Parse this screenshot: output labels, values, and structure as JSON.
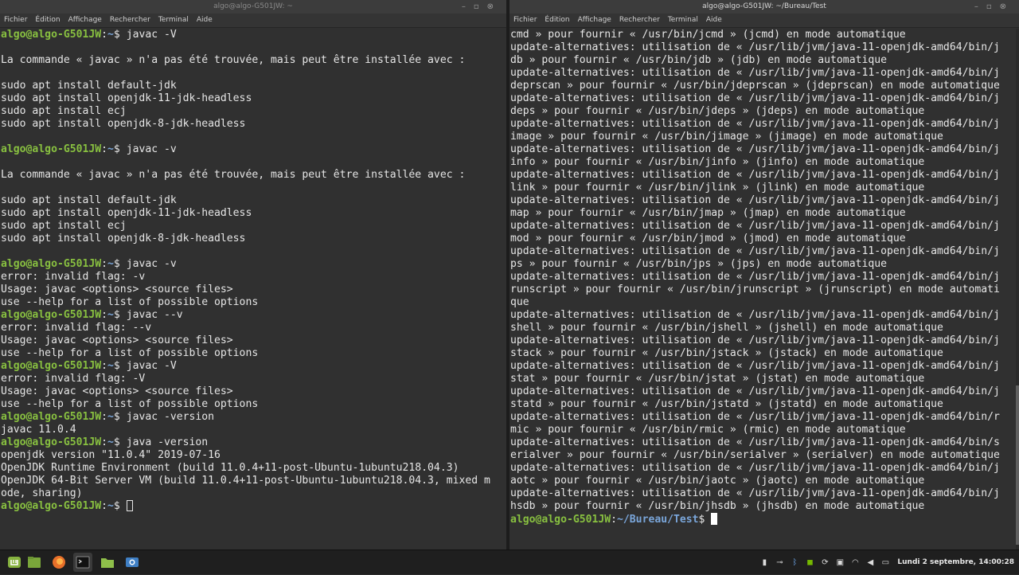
{
  "left": {
    "title": "algo@algo-G501JW: ~",
    "menu": [
      "Fichier",
      "Édition",
      "Affichage",
      "Rechercher",
      "Terminal",
      "Aide"
    ],
    "lines": [
      {
        "user": "algo@algo-G501JW",
        "path": "~",
        "cmd": "$ javac -V"
      },
      {
        "text": ""
      },
      {
        "text": "La commande « javac » n'a pas été trouvée, mais peut être installée avec :"
      },
      {
        "text": ""
      },
      {
        "text": "sudo apt install default-jdk"
      },
      {
        "text": "sudo apt install openjdk-11-jdk-headless"
      },
      {
        "text": "sudo apt install ecj"
      },
      {
        "text": "sudo apt install openjdk-8-jdk-headless"
      },
      {
        "text": ""
      },
      {
        "user": "algo@algo-G501JW",
        "path": "~",
        "cmd": "$ javac -v"
      },
      {
        "text": ""
      },
      {
        "text": "La commande « javac » n'a pas été trouvée, mais peut être installée avec :"
      },
      {
        "text": ""
      },
      {
        "text": "sudo apt install default-jdk"
      },
      {
        "text": "sudo apt install openjdk-11-jdk-headless"
      },
      {
        "text": "sudo apt install ecj"
      },
      {
        "text": "sudo apt install openjdk-8-jdk-headless"
      },
      {
        "text": ""
      },
      {
        "user": "algo@algo-G501JW",
        "path": "~",
        "cmd": "$ javac -v"
      },
      {
        "text": "error: invalid flag: -v"
      },
      {
        "text": "Usage: javac <options> <source files>"
      },
      {
        "text": "use --help for a list of possible options"
      },
      {
        "user": "algo@algo-G501JW",
        "path": "~",
        "cmd": "$ javac --v"
      },
      {
        "text": "error: invalid flag: --v"
      },
      {
        "text": "Usage: javac <options> <source files>"
      },
      {
        "text": "use --help for a list of possible options"
      },
      {
        "user": "algo@algo-G501JW",
        "path": "~",
        "cmd": "$ javac -V"
      },
      {
        "text": "error: invalid flag: -V"
      },
      {
        "text": "Usage: javac <options> <source files>"
      },
      {
        "text": "use --help for a list of possible options"
      },
      {
        "user": "algo@algo-G501JW",
        "path": "~",
        "cmd": "$ javac -version"
      },
      {
        "text": "javac 11.0.4"
      },
      {
        "user": "algo@algo-G501JW",
        "path": "~",
        "cmd": "$ java -version"
      },
      {
        "text": "openjdk version \"11.0.4\" 2019-07-16"
      },
      {
        "text": "OpenJDK Runtime Environment (build 11.0.4+11-post-Ubuntu-1ubuntu218.04.3)"
      },
      {
        "text": "OpenJDK 64-Bit Server VM (build 11.0.4+11-post-Ubuntu-1ubuntu218.04.3, mixed m"
      },
      {
        "text": "ode, sharing)"
      },
      {
        "user": "algo@algo-G501JW",
        "path": "~",
        "cmd": "$ ",
        "cursor": "hollow"
      }
    ]
  },
  "right": {
    "title": "algo@algo-G501JW: ~/Bureau/Test",
    "menu": [
      "Fichier",
      "Édition",
      "Affichage",
      "Rechercher",
      "Terminal",
      "Aide"
    ],
    "lines": [
      {
        "text": "cmd » pour fournir « /usr/bin/jcmd » (jcmd) en mode automatique"
      },
      {
        "text": "update-alternatives: utilisation de « /usr/lib/jvm/java-11-openjdk-amd64/bin/j"
      },
      {
        "text": "db » pour fournir « /usr/bin/jdb » (jdb) en mode automatique"
      },
      {
        "text": "update-alternatives: utilisation de « /usr/lib/jvm/java-11-openjdk-amd64/bin/j"
      },
      {
        "text": "deprscan » pour fournir « /usr/bin/jdeprscan » (jdeprscan) en mode automatique"
      },
      {
        "text": "update-alternatives: utilisation de « /usr/lib/jvm/java-11-openjdk-amd64/bin/j"
      },
      {
        "text": "deps » pour fournir « /usr/bin/jdeps » (jdeps) en mode automatique"
      },
      {
        "text": "update-alternatives: utilisation de « /usr/lib/jvm/java-11-openjdk-amd64/bin/j"
      },
      {
        "text": "image » pour fournir « /usr/bin/jimage » (jimage) en mode automatique"
      },
      {
        "text": "update-alternatives: utilisation de « /usr/lib/jvm/java-11-openjdk-amd64/bin/j"
      },
      {
        "text": "info » pour fournir « /usr/bin/jinfo » (jinfo) en mode automatique"
      },
      {
        "text": "update-alternatives: utilisation de « /usr/lib/jvm/java-11-openjdk-amd64/bin/j"
      },
      {
        "text": "link » pour fournir « /usr/bin/jlink » (jlink) en mode automatique"
      },
      {
        "text": "update-alternatives: utilisation de « /usr/lib/jvm/java-11-openjdk-amd64/bin/j"
      },
      {
        "text": "map » pour fournir « /usr/bin/jmap » (jmap) en mode automatique"
      },
      {
        "text": "update-alternatives: utilisation de « /usr/lib/jvm/java-11-openjdk-amd64/bin/j"
      },
      {
        "text": "mod » pour fournir « /usr/bin/jmod » (jmod) en mode automatique"
      },
      {
        "text": "update-alternatives: utilisation de « /usr/lib/jvm/java-11-openjdk-amd64/bin/j"
      },
      {
        "text": "ps » pour fournir « /usr/bin/jps » (jps) en mode automatique"
      },
      {
        "text": "update-alternatives: utilisation de « /usr/lib/jvm/java-11-openjdk-amd64/bin/j"
      },
      {
        "text": "runscript » pour fournir « /usr/bin/jrunscript » (jrunscript) en mode automati"
      },
      {
        "text": "que"
      },
      {
        "text": "update-alternatives: utilisation de « /usr/lib/jvm/java-11-openjdk-amd64/bin/j"
      },
      {
        "text": "shell » pour fournir « /usr/bin/jshell » (jshell) en mode automatique"
      },
      {
        "text": "update-alternatives: utilisation de « /usr/lib/jvm/java-11-openjdk-amd64/bin/j"
      },
      {
        "text": "stack » pour fournir « /usr/bin/jstack » (jstack) en mode automatique"
      },
      {
        "text": "update-alternatives: utilisation de « /usr/lib/jvm/java-11-openjdk-amd64/bin/j"
      },
      {
        "text": "stat » pour fournir « /usr/bin/jstat » (jstat) en mode automatique"
      },
      {
        "text": "update-alternatives: utilisation de « /usr/lib/jvm/java-11-openjdk-amd64/bin/j"
      },
      {
        "text": "statd » pour fournir « /usr/bin/jstatd » (jstatd) en mode automatique"
      },
      {
        "text": "update-alternatives: utilisation de « /usr/lib/jvm/java-11-openjdk-amd64/bin/r"
      },
      {
        "text": "mic » pour fournir « /usr/bin/rmic » (rmic) en mode automatique"
      },
      {
        "text": "update-alternatives: utilisation de « /usr/lib/jvm/java-11-openjdk-amd64/bin/s"
      },
      {
        "text": "erialver » pour fournir « /usr/bin/serialver » (serialver) en mode automatique"
      },
      {
        "text": "update-alternatives: utilisation de « /usr/lib/jvm/java-11-openjdk-amd64/bin/j"
      },
      {
        "text": "aotc » pour fournir « /usr/bin/jaotc » (jaotc) en mode automatique"
      },
      {
        "text": "update-alternatives: utilisation de « /usr/lib/jvm/java-11-openjdk-amd64/bin/j"
      },
      {
        "text": "hsdb » pour fournir « /usr/bin/jhsdb » (jhsdb) en mode automatique"
      },
      {
        "user": "algo@algo-G501JW",
        "path": "~/Bureau/Test",
        "cmd": "$ ",
        "cursor": "solid"
      }
    ]
  },
  "taskbar": {
    "apps": [
      "menu-icon",
      "files-icon",
      "firefox-icon",
      "terminal-icon",
      "folder-icon",
      "screenshot-icon"
    ],
    "clock": "Lundi 2 septembre, 14:00:28"
  },
  "colors": {
    "prompt_user": "#88c040",
    "prompt_path": "#7aa6da",
    "terminal_bg": "#303030"
  }
}
